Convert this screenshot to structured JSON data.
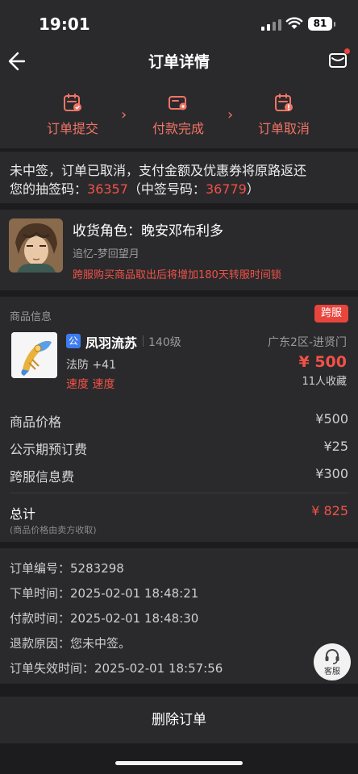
{
  "status_bar": {
    "time": "19:01",
    "battery": "81"
  },
  "nav": {
    "title": "订单详情"
  },
  "steps": [
    {
      "label": "订单提交",
      "icon": "calendar-check-icon"
    },
    {
      "label": "付款完成",
      "icon": "wallet-icon"
    },
    {
      "label": "订单取消",
      "icon": "calendar-alert-icon"
    }
  ],
  "notice": {
    "line1": "未中签，订单已取消，支付金额及优惠券将原路返还",
    "code_label": "您的抽签码：",
    "code": "36357",
    "win_prefix": "（中签号码：",
    "win_code": "36779",
    "win_suffix": "）"
  },
  "role": {
    "name": "收货角色：晚安邓布利多",
    "server": "追忆-梦回望月",
    "warning": "跨服购买商品取出后将增加180天转服时间锁"
  },
  "goods": {
    "header": "商品信息",
    "cross_tag": "跨服",
    "public_badge": "公",
    "name": "凤羽流苏",
    "level": "140级",
    "region": "广东2区-进贤门",
    "attr": "法防 +41",
    "price": "¥ 500",
    "skills": "速度 速度",
    "favorites": "11人收藏"
  },
  "fees": [
    {
      "label": "商品价格",
      "value": "¥500"
    },
    {
      "label": "公示期预订费",
      "value": "¥25"
    },
    {
      "label": "跨服信息费",
      "value": "¥300"
    }
  ],
  "total": {
    "label": "总计",
    "value": "¥ 825",
    "note": "(商品价格由卖方收取)"
  },
  "order": [
    {
      "label": "订单编号：",
      "value": "5283298"
    },
    {
      "label": "下单时间：",
      "value": "2025-02-01 18:48:21"
    },
    {
      "label": "付款时间：",
      "value": "2025-02-01 18:48:30"
    },
    {
      "label": "退款原因：",
      "value": "您未中签。"
    },
    {
      "label": "订单失效时间：",
      "value": "2025-02-01 18:57:56"
    }
  ],
  "service": {
    "label": "客服"
  },
  "bottom": {
    "delete_label": "删除订单"
  },
  "colors": {
    "accent": "#f25148",
    "step": "#f07466",
    "badge_blue": "#3d7cf0"
  }
}
